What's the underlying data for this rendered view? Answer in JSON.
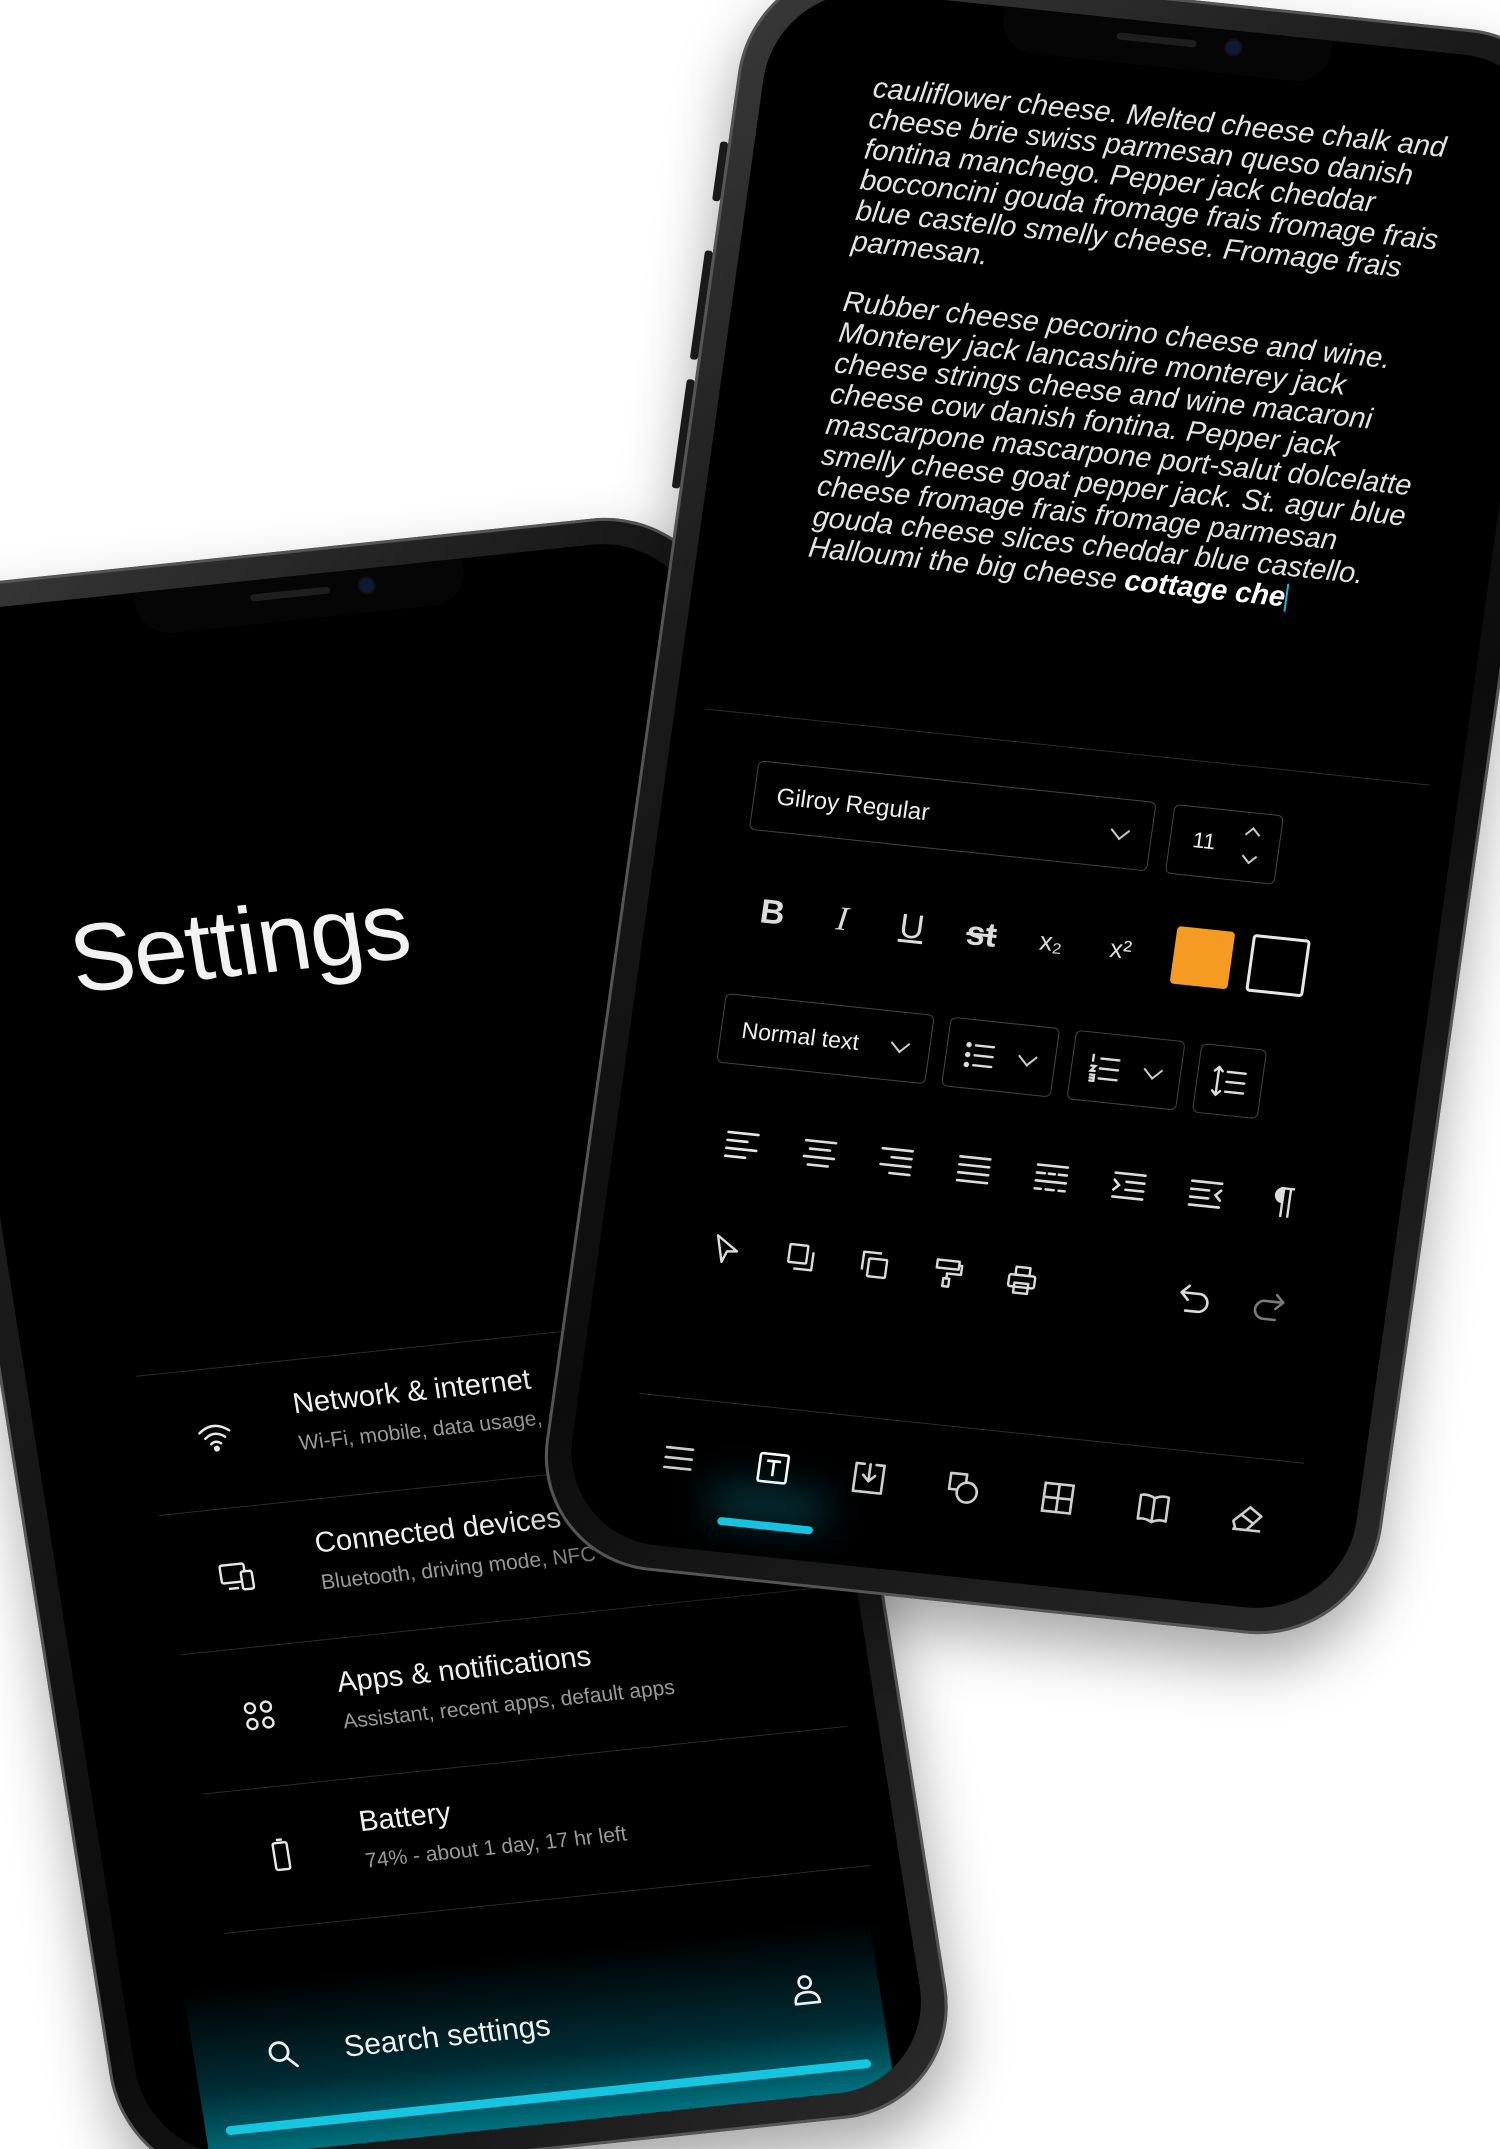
{
  "settings_screen": {
    "title": "Settings",
    "items": [
      {
        "icon": "wifi-icon",
        "title": "Network & internet",
        "subtitle": "Wi-Fi, mobile, data usage, and hot"
      },
      {
        "icon": "devices-icon",
        "title": "Connected devices",
        "subtitle": "Bluetooth, driving mode, NFC"
      },
      {
        "icon": "apps-icon",
        "title": "Apps & notifications",
        "subtitle": "Assistant, recent apps, default apps"
      },
      {
        "icon": "battery-icon",
        "title": "Battery",
        "subtitle": "74% - about 1 day, 17 hr left"
      }
    ],
    "search": {
      "placeholder": "Search settings",
      "search_icon": "search-icon",
      "account_icon": "account-icon"
    },
    "accent_color": "#16c5e0"
  },
  "editor_screen": {
    "document": {
      "paragraph_1": "cauliflower cheese. Melted cheese chalk and cheese brie swiss parmesan queso danish fontina manchego. Pepper jack cheddar bocconcini gouda fromage frais fromage frais blue castello smelly cheese. Fromage frais parmesan.",
      "paragraph_2": "Rubber cheese pecorino cheese and wine. Monterey jack lancashire monterey jack cheese strings cheese and wine macaroni cheese cow danish fontina. Pepper jack mascarpone mascarpone port-salut dolcelatte smelly cheese goat pepper jack. St. agur blue cheese fromage frais fromage parmesan gouda cheese slices cheddar blue castello. Halloumi the big cheese ",
      "paragraph_2_bold": "cottage che"
    },
    "font_family": "Gilroy Regular",
    "font_size": "11",
    "format_buttons": {
      "bold": "B",
      "italic": "I",
      "underline": "U",
      "strikethrough": "st",
      "subscript": "x₂",
      "superscript": "x²"
    },
    "text_color": "#f59a23",
    "highlight_color": "#000000",
    "paragraph_style": "Normal text",
    "bottom_nav": [
      {
        "icon": "menu-icon",
        "active": false
      },
      {
        "icon": "text-icon",
        "active": true
      },
      {
        "icon": "insert-icon",
        "active": false
      },
      {
        "icon": "shapes-icon",
        "active": false
      },
      {
        "icon": "table-icon",
        "active": false
      },
      {
        "icon": "book-icon",
        "active": false
      },
      {
        "icon": "eraser-icon",
        "active": false
      }
    ],
    "accent_color": "#17c3de"
  }
}
